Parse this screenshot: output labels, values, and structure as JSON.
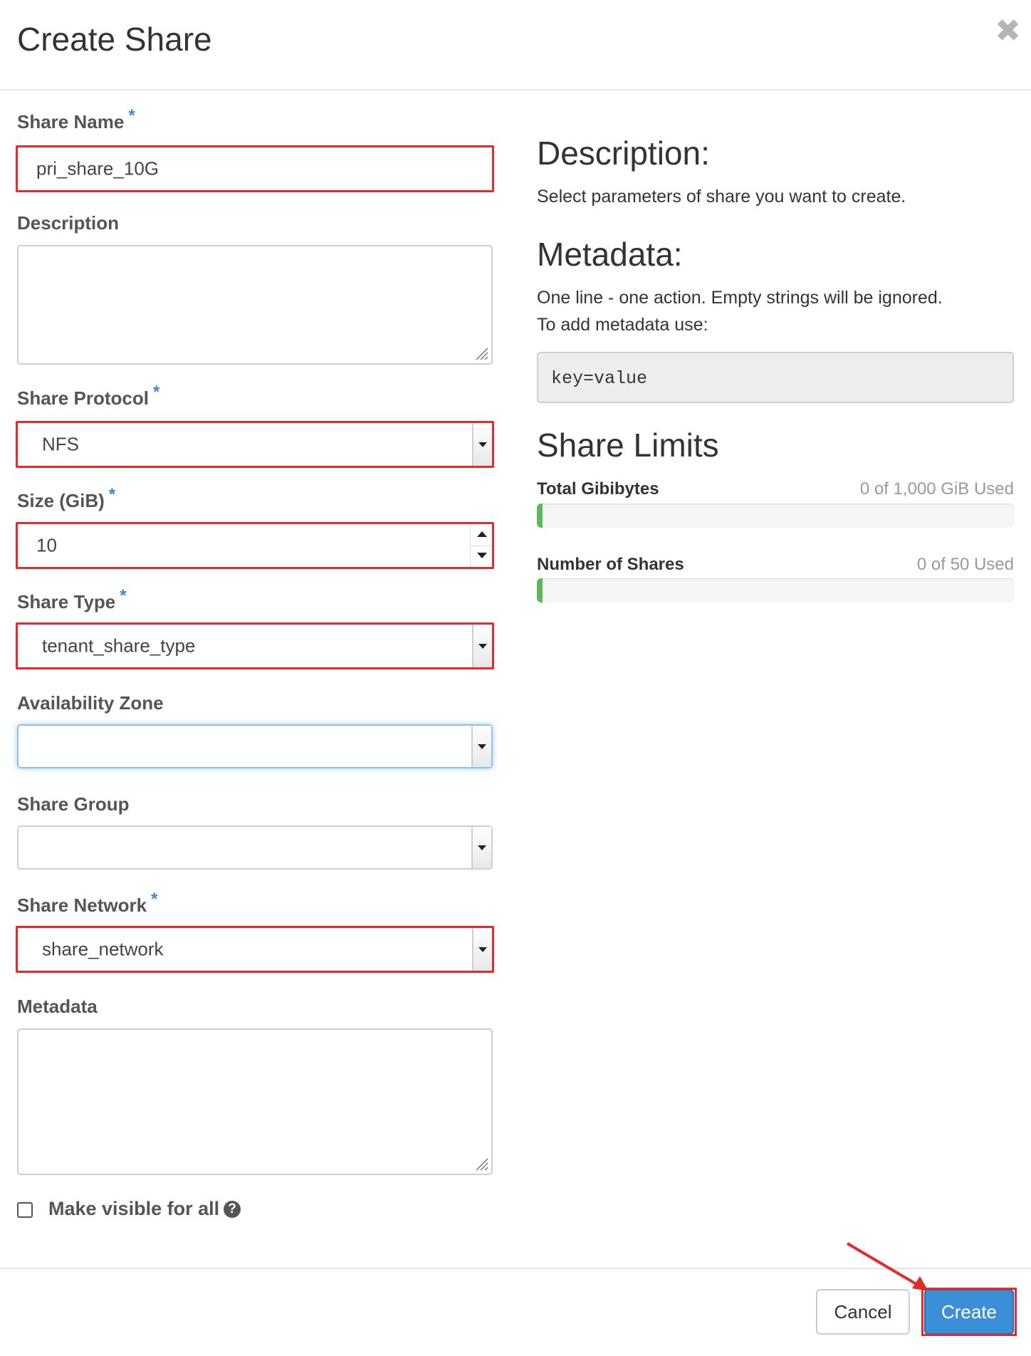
{
  "dialog": {
    "title": "Create Share",
    "close_glyph": "✖"
  },
  "form": {
    "share_name": {
      "label": "Share Name",
      "value": "pri_share_10G"
    },
    "description": {
      "label": "Description",
      "value": ""
    },
    "share_protocol": {
      "label": "Share Protocol",
      "value": "NFS"
    },
    "size": {
      "label": "Size (GiB)",
      "value": "10"
    },
    "share_type": {
      "label": "Share Type",
      "value": "tenant_share_type"
    },
    "availability_zone": {
      "label": "Availability Zone",
      "value": ""
    },
    "share_group": {
      "label": "Share Group",
      "value": ""
    },
    "share_network": {
      "label": "Share Network",
      "value": "share_network"
    },
    "metadata": {
      "label": "Metadata",
      "value": ""
    },
    "make_visible": {
      "label": "Make visible for all",
      "checked": false,
      "help_glyph": "?"
    },
    "required_marker": "*"
  },
  "sidebar": {
    "description_heading": "Description:",
    "description_text": "Select parameters of share you want to create.",
    "metadata_heading": "Metadata:",
    "metadata_text_1": "One line - one action. Empty strings will be ignored.",
    "metadata_text_2": "To add metadata use:",
    "metadata_example": "key=value",
    "limits_heading": "Share Limits",
    "limits": [
      {
        "label": "Total Gibibytes",
        "used_text": "0 of 1,000 GiB Used",
        "used": 0,
        "total": 1000
      },
      {
        "label": "Number of Shares",
        "used_text": "0 of 50 Used",
        "used": 0,
        "total": 50
      }
    ],
    "bar_color": "#5cb85c"
  },
  "footer": {
    "cancel_label": "Cancel",
    "create_label": "Create"
  },
  "colors": {
    "highlight": "#e32b2b",
    "primary": "#3a8fd6",
    "required": "#3a87d6"
  }
}
